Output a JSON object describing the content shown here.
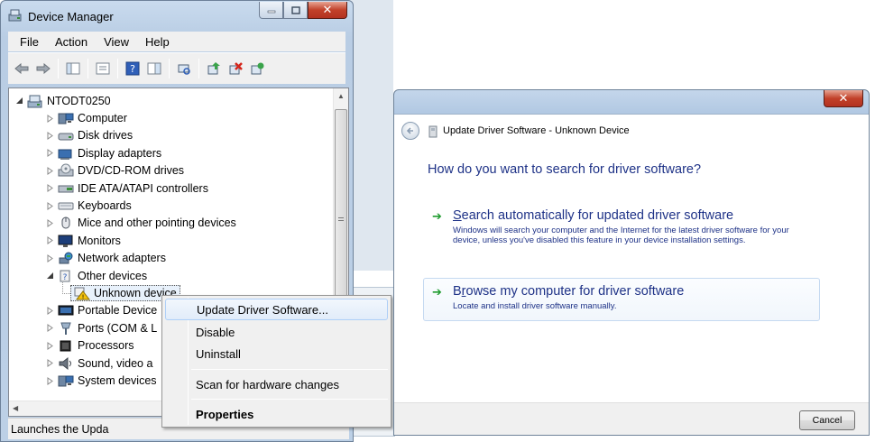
{
  "device_manager": {
    "title": "Device Manager",
    "menu": [
      "File",
      "Action",
      "View",
      "Help"
    ],
    "toolbar_icons": [
      "back-icon",
      "forward-icon",
      "show-hide-console-tree-icon",
      "properties-icon",
      "help-icon",
      "view-icon",
      "scan-hardware-icon",
      "update-driver-icon",
      "uninstall-icon",
      "enable-icon"
    ],
    "tree": {
      "root": "NTODT0250",
      "items": [
        {
          "label": "Computer",
          "icon": "computer-icon",
          "state": "collapsed"
        },
        {
          "label": "Disk drives",
          "icon": "disk-drive-icon",
          "state": "collapsed"
        },
        {
          "label": "Display adapters",
          "icon": "display-adapter-icon",
          "state": "collapsed"
        },
        {
          "label": "DVD/CD-ROM drives",
          "icon": "dvd-drive-icon",
          "state": "collapsed"
        },
        {
          "label": "IDE ATA/ATAPI controllers",
          "icon": "ide-controller-icon",
          "state": "collapsed"
        },
        {
          "label": "Keyboards",
          "icon": "keyboard-icon",
          "state": "collapsed"
        },
        {
          "label": "Mice and other pointing devices",
          "icon": "mouse-icon",
          "state": "collapsed"
        },
        {
          "label": "Monitors",
          "icon": "monitor-icon",
          "state": "collapsed"
        },
        {
          "label": "Network adapters",
          "icon": "network-adapter-icon",
          "state": "collapsed"
        },
        {
          "label": "Other devices",
          "icon": "other-devices-icon",
          "state": "expanded"
        },
        {
          "label": "Unknown device",
          "icon": "unknown-device-warning-icon",
          "state": "child",
          "selected": true
        },
        {
          "label": "Portable Device",
          "icon": "portable-device-icon",
          "state": "collapsed"
        },
        {
          "label": "Ports (COM & L",
          "icon": "ports-icon",
          "state": "collapsed"
        },
        {
          "label": "Processors",
          "icon": "processor-icon",
          "state": "collapsed"
        },
        {
          "label": "Sound, video a",
          "icon": "sound-icon",
          "state": "collapsed"
        },
        {
          "label": "System devices",
          "icon": "system-devices-icon",
          "state": "collapsed"
        }
      ]
    },
    "status": "Launches the Upda"
  },
  "context_menu": {
    "items": [
      {
        "label": "Update Driver Software...",
        "hover": true
      },
      {
        "label": "Disable"
      },
      {
        "label": "Uninstall"
      },
      {
        "label": "Scan for hardware changes"
      },
      {
        "label": "Properties",
        "bold": true
      }
    ]
  },
  "update_driver": {
    "title": "Update Driver Software - Unknown Device",
    "question": "How do you want to search for driver software?",
    "options": [
      {
        "accel": "S",
        "title_rest": "earch automatically for updated driver software",
        "desc": "Windows will search your computer and the Internet for the latest driver software for your device, unless you've disabled this feature in your device installation settings."
      },
      {
        "accel": "r",
        "title_pre": "B",
        "title_rest": "owse my computer for driver software",
        "desc": "Locate and install driver software manually."
      }
    ],
    "cancel": "Cancel"
  },
  "colors": {
    "link_blue": "#1e3287",
    "arrow_green": "#1f9b2f",
    "close_red": "#c2412a",
    "selection": "#e8f1fb"
  }
}
